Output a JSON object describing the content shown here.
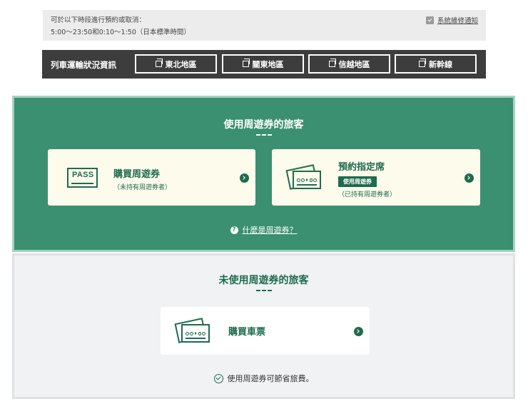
{
  "notice": {
    "line1": "可於以下時段進行預約或取消：",
    "line2": "5:00～23:50和0:10～1:50（日本標準時間）",
    "maintenance_link": "系統維修通知"
  },
  "train_status": {
    "title": "列車運輸狀況資訊",
    "buttons": [
      "東北地區",
      "關東地區",
      "信越地區",
      "新幹線"
    ]
  },
  "pass_users": {
    "title": "使用周遊券的旅客",
    "buy_pass": {
      "icon_text": "PASS",
      "title": "購買周遊券",
      "subtitle": "（未持有周遊券者）"
    },
    "reserve_seat": {
      "title": "預約指定席",
      "badge": "使用周遊券",
      "subtitle": "（已持有周遊券者）"
    },
    "help_link": "什麼是周遊券？"
  },
  "non_pass_users": {
    "title": "未使用周遊券的旅客",
    "buy_ticket": {
      "title": "購買車票"
    },
    "note": "使用周遊券可節省旅費。"
  },
  "colors": {
    "green": "#3a9070",
    "dark_green": "#1e6b4e",
    "card_bg": "#fdfbec",
    "status_bar": "#3d3d3d"
  }
}
